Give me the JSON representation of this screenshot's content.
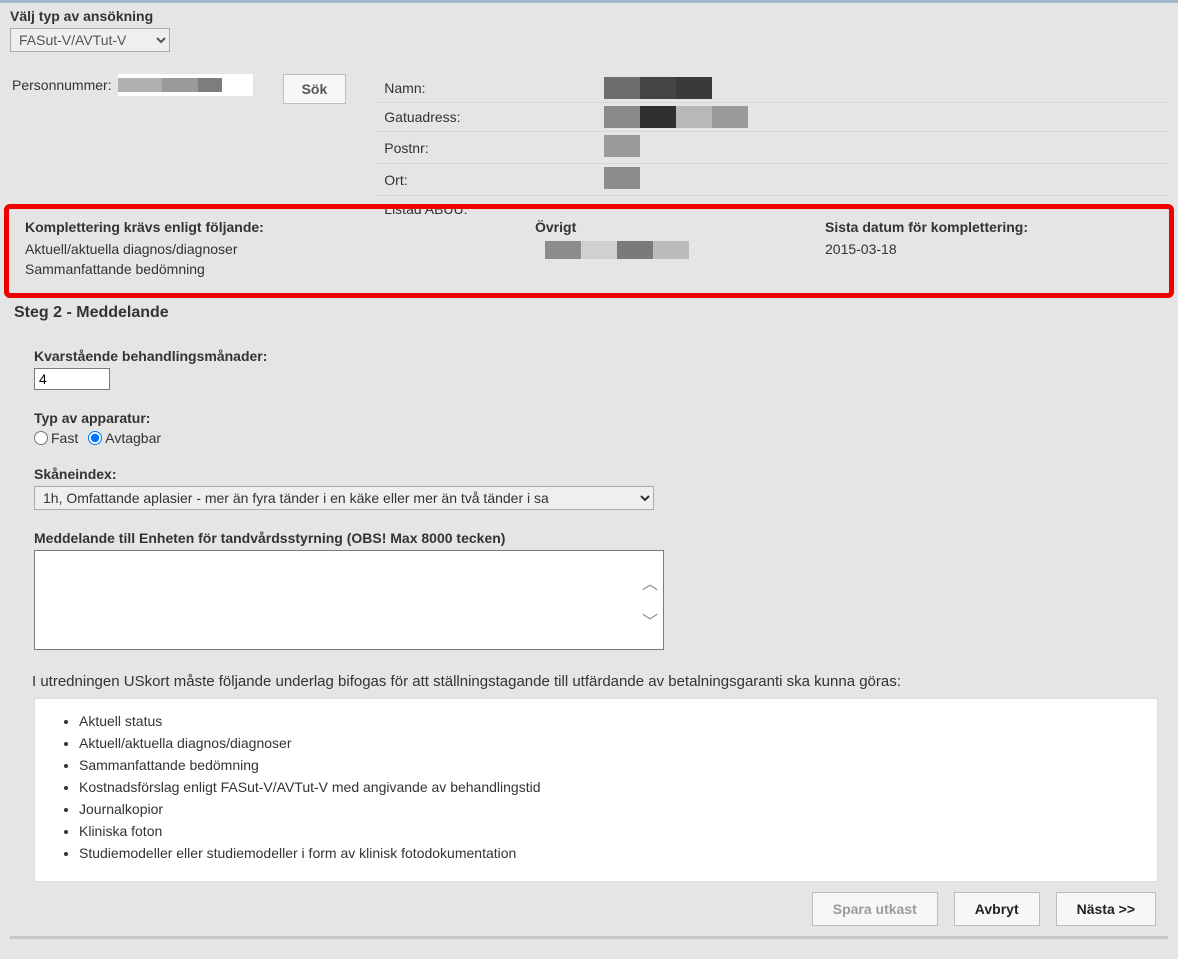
{
  "app_type": {
    "label": "Välj typ av ansökning",
    "value": "FASut-V/AVTut-V"
  },
  "search": {
    "pnr_label": "Personnummer:",
    "search_btn": "Sök"
  },
  "details": {
    "name_label": "Namn:",
    "street_label": "Gatuadress:",
    "postal_label": "Postnr:",
    "city_label": "Ort:",
    "listed_label": "Listad ABUU:"
  },
  "komp": {
    "header1": "Komplettering krävs enligt följande:",
    "item1": "Aktuell/aktuella diagnos/diagnoser",
    "item2": "Sammanfattande bedömning",
    "header2": "Övrigt",
    "header3": "Sista datum för komplettering:",
    "date": "2015-03-18"
  },
  "step_title": "Steg 2 - Meddelande",
  "months": {
    "label": "Kvarstående behandlingsmånader:",
    "value": "4"
  },
  "apparatus": {
    "label": "Typ av apparatur:",
    "opt1": "Fast",
    "opt2": "Avtagbar"
  },
  "skane": {
    "label": "Skåneindex:",
    "value": "1h, Omfattande aplasier - mer än fyra tänder i en käke eller mer än två tänder i sa"
  },
  "message": {
    "label": "Meddelande till Enheten för tandvårdsstyrning (OBS! Max 8000 tecken)"
  },
  "instructions": "I utredningen USkort måste följande underlag bifogas för att ställningstagande till utfärdande av betalningsgaranti ska kunna göras:",
  "bullets": [
    "Aktuell status",
    "Aktuell/aktuella diagnos/diagnoser",
    "Sammanfattande bedömning",
    "Kostnadsförslag enligt FASut-V/AVTut-V med angivande av behandlingstid",
    "Journalkopior",
    "Kliniska foton",
    "Studiemodeller eller studiemodeller i form av klinisk fotodokumentation"
  ],
  "buttons": {
    "save_draft": "Spara utkast",
    "cancel": "Avbryt",
    "next": "Nästa >>"
  }
}
